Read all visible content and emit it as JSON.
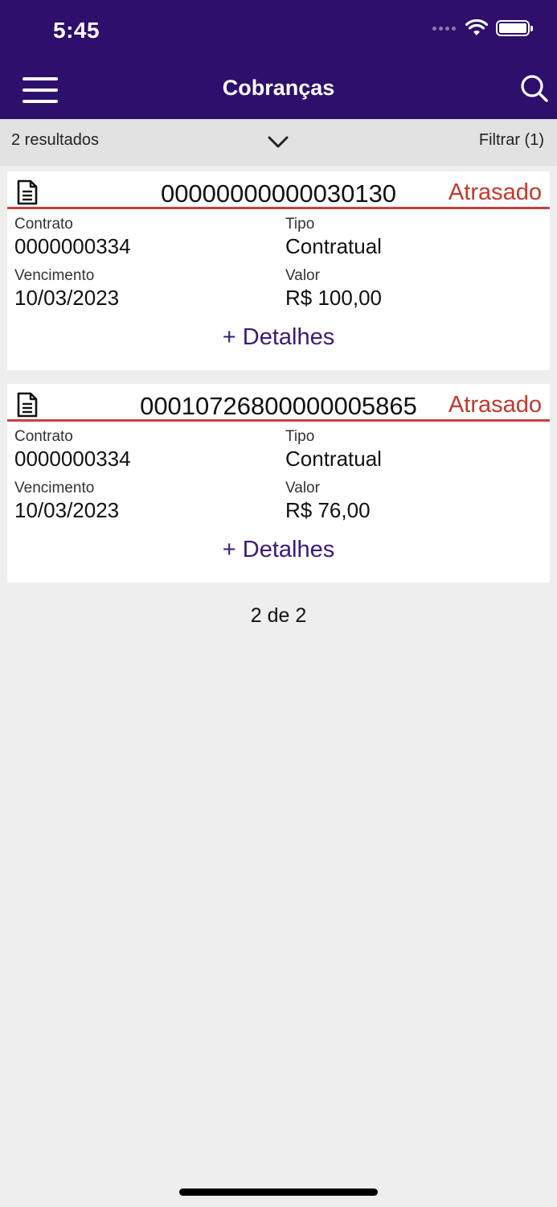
{
  "status_bar": {
    "time": "5:45"
  },
  "header": {
    "title": "Cobranças"
  },
  "filter_bar": {
    "results": "2 resultados",
    "filter_label": "Filtrar (1)"
  },
  "cards": [
    {
      "number": "00000000000030130",
      "status": "Atrasado",
      "contrato_label": "Contrato",
      "contrato": "0000000334",
      "tipo_label": "Tipo",
      "tipo": "Contratual",
      "vencimento_label": "Vencimento",
      "vencimento": "10/03/2023",
      "valor_label": "Valor",
      "valor": "R$ 100,00",
      "details_label": "+ Detalhes"
    },
    {
      "number": "00010726800000005865",
      "status": "Atrasado",
      "contrato_label": "Contrato",
      "contrato": "0000000334",
      "tipo_label": "Tipo",
      "tipo": "Contratual",
      "vencimento_label": "Vencimento",
      "vencimento": "10/03/2023",
      "valor_label": "Valor",
      "valor": "R$ 76,00",
      "details_label": "+ Detalhes"
    }
  ],
  "pager": "2 de 2",
  "colors": {
    "header_bg": "#2e0f6b",
    "status_overdue": "#c0392b",
    "link": "#3a1a7a"
  },
  "icons": [
    "menu-icon",
    "search-icon",
    "chevron-down-icon",
    "document-icon",
    "wifi-icon",
    "battery-icon"
  ]
}
